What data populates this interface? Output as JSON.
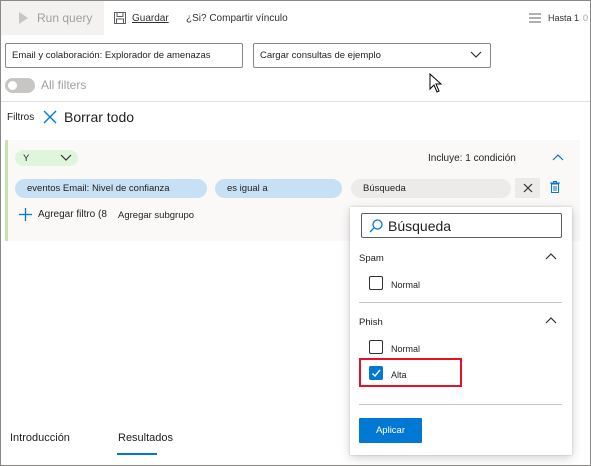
{
  "toolbar": {
    "run_query": "Run query",
    "save": "Guardar",
    "share": "¿Si? Compartir vínculo",
    "hasta": "Hasta 1",
    "count": "0"
  },
  "query": {
    "schema_value": "Email y colaboración: Explorador de amenazas",
    "sample_placeholder": "Cargar consultas de ejemplo"
  },
  "all_filters_label": "All filters",
  "filters": {
    "label": "Filtros",
    "clear_all": "Borrar todo",
    "group_operator": "Y",
    "includes": "Incluye: 1 condición",
    "field": "eventos Email: Nivel de confianza",
    "operator": "es igual a",
    "value_placeholder": "Búsqueda",
    "add_filter": "Agregar filtro (8",
    "add_subgroup": "Agregar subgrupo"
  },
  "popup": {
    "search": "Búsqueda",
    "sections": [
      {
        "title": "Spam",
        "options": [
          {
            "label": "Normal",
            "checked": false
          }
        ]
      },
      {
        "title": "Phish",
        "options": [
          {
            "label": "Normal",
            "checked": false
          },
          {
            "label": "Alta",
            "checked": true
          }
        ]
      }
    ],
    "apply": "Aplicar"
  },
  "tabs": [
    {
      "label": "Introducción",
      "active": false
    },
    {
      "label": "Resultados",
      "active": true
    }
  ],
  "colors": {
    "accent": "#0078d4",
    "highlight_border": "#e81123",
    "pill_blue": "#c7e0f4",
    "operator_green": "#dff6dd"
  }
}
